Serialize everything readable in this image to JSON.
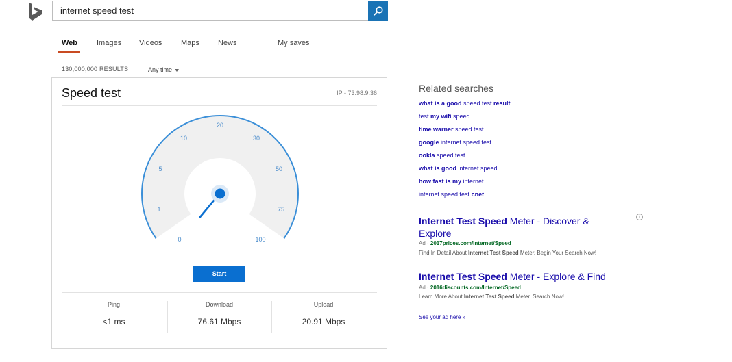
{
  "header": {
    "logo_icon": "bing-logo-icon",
    "search_value": "internet speed test",
    "search_icon": "search-icon",
    "brand_color": "#1a73b5"
  },
  "nav": {
    "tabs": [
      {
        "label": "Web",
        "active": true
      },
      {
        "label": "Images",
        "active": false
      },
      {
        "label": "Videos",
        "active": false
      },
      {
        "label": "Maps",
        "active": false
      },
      {
        "label": "News",
        "active": false
      },
      {
        "label": "My saves",
        "active": false
      }
    ],
    "active_color": "#c94b22"
  },
  "results": {
    "count": "130,000,000 RESULTS",
    "time_filter": "Any time"
  },
  "speed_test": {
    "title": "Speed test",
    "ip": "IP - 73.98.9.36",
    "gauge_ticks": [
      "0",
      "1",
      "5",
      "10",
      "20",
      "30",
      "50",
      "75",
      "100"
    ],
    "gauge_color": "#3b8fd8",
    "start_label": "Start",
    "stats": [
      {
        "label": "Ping",
        "value": "<1 ms"
      },
      {
        "label": "Download",
        "value": "76.61 Mbps"
      },
      {
        "label": "Upload",
        "value": "20.91 Mbps"
      }
    ]
  },
  "related": {
    "title": "Related searches",
    "items": [
      [
        {
          "t": "what is a good",
          "b": true
        },
        {
          "t": " speed test ",
          "b": false
        },
        {
          "t": "result",
          "b": true
        }
      ],
      [
        {
          "t": "test ",
          "b": false
        },
        {
          "t": "my wifi",
          "b": true
        },
        {
          "t": " speed",
          "b": false
        }
      ],
      [
        {
          "t": "time warner",
          "b": true
        },
        {
          "t": " speed test",
          "b": false
        }
      ],
      [
        {
          "t": "google",
          "b": true
        },
        {
          "t": " internet speed test",
          "b": false
        }
      ],
      [
        {
          "t": "ookla",
          "b": true
        },
        {
          "t": " speed test",
          "b": false
        }
      ],
      [
        {
          "t": "what is good",
          "b": true
        },
        {
          "t": " internet speed",
          "b": false
        }
      ],
      [
        {
          "t": "how fast is my",
          "b": true
        },
        {
          "t": " internet",
          "b": false
        }
      ],
      [
        {
          "t": "internet speed test ",
          "b": false
        },
        {
          "t": "cnet",
          "b": true
        }
      ]
    ]
  },
  "ads": [
    {
      "title_bold": "Internet Test Speed",
      "title_rest_line1": " Meter - Discover &",
      "title_rest_line2": "Explore",
      "ad_tag": "Ad · ",
      "url": "2017prices.com/Internet/Speed",
      "desc_pre": "Find In Detail About ",
      "desc_bold": "Internet Test Speed",
      "desc_post": " Meter. Begin Your Search Now!"
    },
    {
      "title_bold": "Internet Test Speed",
      "title_rest_line1": " Meter - Explore & Find",
      "ad_tag": "Ad · ",
      "url": "2016discounts.com/Internet/Speed",
      "desc_pre": "Learn More About ",
      "desc_bold": "Internet Test Speed",
      "desc_post": " Meter. Search Now!"
    }
  ],
  "ad_info_icon": "info-icon",
  "ad_info_glyph": "i",
  "see_ad": "See your ad here »"
}
